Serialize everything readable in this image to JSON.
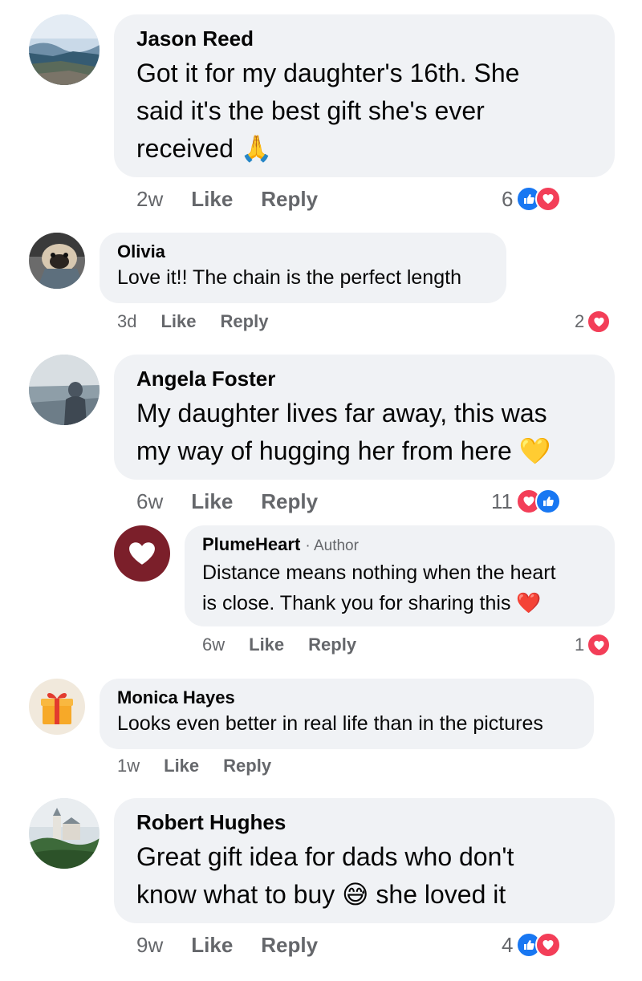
{
  "colors": {
    "bubble": "#f0f2f5",
    "meta_text": "#65676b",
    "heart_reaction": "#f33e58",
    "like_reaction": "#1877f2",
    "author_avatar": "#7b1f2a"
  },
  "comments": [
    {
      "name": "Jason Reed",
      "text_lines": [
        "Got it for my daughter's 16th. She",
        "said it's the best gift she's ever",
        "received 🙏"
      ],
      "time": "2w",
      "like": "Like",
      "reply": "Reply",
      "reaction_count": "6",
      "reactions": [
        "like-icon",
        "heart-icon"
      ]
    },
    {
      "name": "Olivia",
      "text_lines": [
        "Love it!! The chain is the perfect length"
      ],
      "time": "3d",
      "like": "Like",
      "reply": "Reply",
      "reaction_count": "2",
      "reactions": [
        "heart-icon"
      ]
    },
    {
      "name": "Angela Foster",
      "text_lines": [
        "My daughter lives far away, this was",
        "my way of hugging her from here 💛"
      ],
      "time": "6w",
      "like": "Like",
      "reply": "Reply",
      "reaction_count": "11",
      "reactions": [
        "heart-icon",
        "like-icon"
      ],
      "replies": [
        {
          "name": "PlumeHeart",
          "author_tag": "· Author",
          "text_lines": [
            "Distance means nothing when the heart",
            "is close. Thank you for sharing this ❤️"
          ],
          "time": "6w",
          "like": "Like",
          "reply": "Reply",
          "reaction_count": "1",
          "reactions": [
            "heart-icon"
          ]
        }
      ]
    },
    {
      "name": "Monica Hayes",
      "text_lines": [
        "Looks even better in real life than in the pictures"
      ],
      "time": "1w",
      "like": "Like",
      "reply": "Reply"
    },
    {
      "name": "Robert Hughes",
      "text_lines": [
        "Great gift idea for dads who don't",
        "know what to buy 😅 she loved it"
      ],
      "time": "9w",
      "like": "Like",
      "reply": "Reply",
      "reaction_count": "4",
      "reactions": [
        "like-icon",
        "heart-icon"
      ]
    }
  ]
}
